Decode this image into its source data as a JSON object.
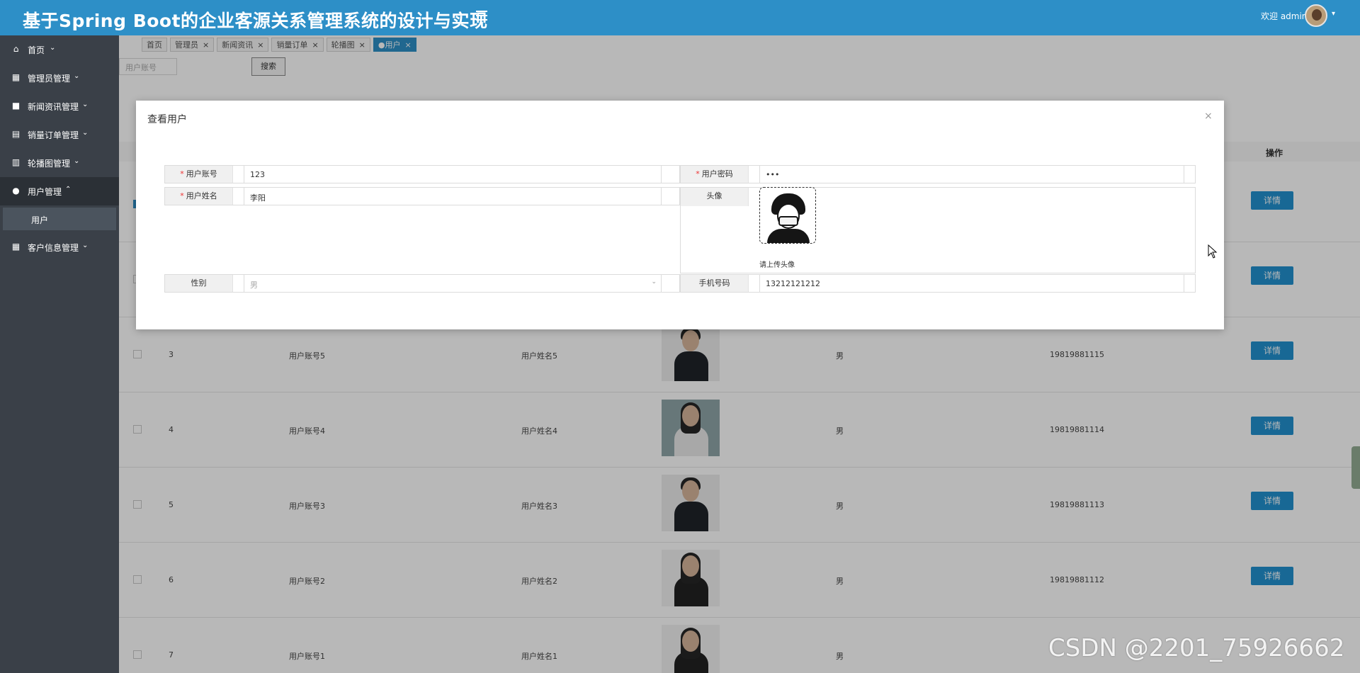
{
  "header": {
    "title": "基于Spring Boot的企业客源关系管理系统的设计与实现",
    "welcome": "欢迎 admin",
    "colors": {
      "header_bg": "#2d8fc7",
      "sidebar_bg": "#3a4048",
      "accent": "#2291cf"
    }
  },
  "sidebar": {
    "items": [
      {
        "label": "首页",
        "icon": "home-icon"
      },
      {
        "label": "管理员管理",
        "icon": "admin-icon"
      },
      {
        "label": "新闻资讯管理",
        "icon": "news-icon"
      },
      {
        "label": "销量订单管理",
        "icon": "order-icon"
      },
      {
        "label": "轮播图管理",
        "icon": "carousel-icon"
      },
      {
        "label": "用户管理",
        "icon": "user-icon"
      },
      {
        "label": "客户信息管理",
        "icon": "customer-icon"
      }
    ],
    "submenu": {
      "label": "用户"
    }
  },
  "tabs": [
    {
      "label": "首页",
      "closable": false
    },
    {
      "label": "管理员",
      "closable": true
    },
    {
      "label": "新闻资讯",
      "closable": true
    },
    {
      "label": "销量订单",
      "closable": true
    },
    {
      "label": "轮播图",
      "closable": true
    },
    {
      "label": "●用户",
      "closable": true,
      "active": true
    }
  ],
  "search": {
    "placeholder": "用户账号",
    "button": "搜索"
  },
  "table": {
    "op_header": "操作",
    "rows": [
      {
        "idx": "3",
        "account": "用户账号5",
        "name": "用户姓名5",
        "sex": "男",
        "phone": "19819881115",
        "action": "详情"
      },
      {
        "idx": "4",
        "account": "用户账号4",
        "name": "用户姓名4",
        "sex": "男",
        "phone": "19819881114",
        "action": "详情"
      },
      {
        "idx": "5",
        "account": "用户账号3",
        "name": "用户姓名3",
        "sex": "男",
        "phone": "19819881113",
        "action": "详情"
      },
      {
        "idx": "6",
        "account": "用户账号2",
        "name": "用户姓名2",
        "sex": "男",
        "phone": "19819881112",
        "action": "详情"
      },
      {
        "idx": "7",
        "account": "用户账号1",
        "name": "用户姓名1",
        "sex": "男",
        "phone": "",
        "action": ""
      }
    ],
    "hidden_row_actions": [
      "详情",
      "详情"
    ]
  },
  "modal": {
    "title": "查看用户",
    "close": "×",
    "fields": {
      "account_label": "用户账号",
      "account_value": "123",
      "password_label": "用户密码",
      "password_value": "•••",
      "name_label": "用户姓名",
      "name_value": "李阳",
      "avatar_label": "头像",
      "avatar_hint": "请上传头像",
      "sex_label": "性别",
      "sex_value": "男",
      "phone_label": "手机号码",
      "phone_value": "13212121212"
    },
    "required_mark": "*"
  },
  "watermark": "CSDN @2201_75926662"
}
